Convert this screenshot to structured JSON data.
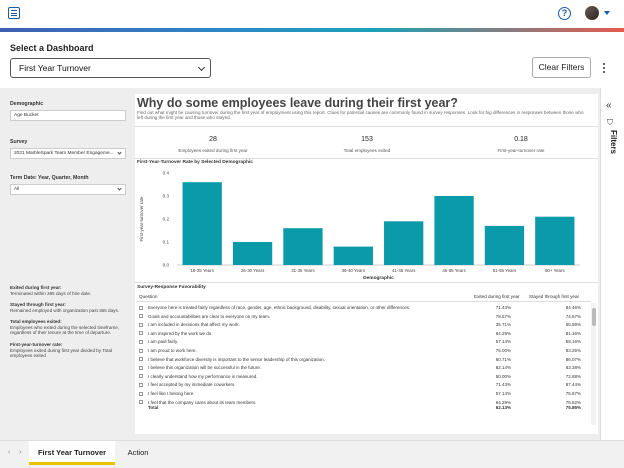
{
  "header": {
    "select_label": "Select a Dashboard",
    "dashboard_value": "First Year Turnover",
    "clear_filters_label": "Clear Filters"
  },
  "filters": {
    "demographic_label": "Demographic",
    "demographic_value": "Age Bucket",
    "survey_label": "Survey",
    "survey_value": "2021 MarbleSpark Team Member Engageme...",
    "term_date_label": "Term Date: Year, Quarter, Month",
    "term_date_value": "All",
    "rail_label": "Filters"
  },
  "definitions": [
    {
      "title": "Exited during first year:",
      "text": "Terminated within 365 days of hire date."
    },
    {
      "title": "Stayed through first year:",
      "text": "Remained employed with organization past 365 days."
    },
    {
      "title": "Total employees exited:",
      "text": "Employees who exited during the selected timeframe, regardless of their tenure at the time of departure."
    },
    {
      "title": "First-year-turnover rate:",
      "text": "Employees exited during first year divided by Total employees exited"
    }
  ],
  "report": {
    "title": "Why do some employees leave during their first year?",
    "subtitle": "Find out what might be causing turnover during the first year of employment using this report.  Clues for potential causes are commonly found in survey responses.  Look for big differences in responses between those who left during the first year and those who stayed."
  },
  "kpis": [
    {
      "value": "28",
      "label": "Employees exited during first year"
    },
    {
      "value": "153",
      "label": "Total employees exited"
    },
    {
      "value": "0.18",
      "label": "First-year-turnover rate"
    }
  ],
  "chart_data": {
    "type": "bar",
    "title": "First-Year-Turnover Rate by Selected Demographic",
    "xlabel": "Demographic",
    "ylabel": "First-year-turnover rate",
    "categories": [
      "18-25 Years",
      "26-30 Years",
      "31-35 Years",
      "36-40 Years",
      "41-45 Years",
      "46-55 Years",
      "51-55 Years",
      "60+ Years"
    ],
    "values": [
      0.36,
      0.1,
      0.16,
      0.08,
      0.19,
      0.3,
      0.17,
      0.21
    ],
    "ylim": [
      0,
      0.4
    ],
    "yticks": [
      "0.0",
      "0.1",
      "0.2",
      "0.3",
      "0.4"
    ],
    "bar_color": "#0a9aaa",
    "grid": false
  },
  "table": {
    "title": "Survey-Response Favorability",
    "col_question": "Question",
    "col_exited": "Exited during first year",
    "col_stayed": "Stayed through first year",
    "rows": [
      {
        "q": "Everyone here is treated fairly regardless of race, gender, age, ethnic background, disability, sexual orientation, or other differences.",
        "a": "71.43%",
        "b": "84.46%"
      },
      {
        "q": "Goals and accountabilities are clear to everyone on my team.",
        "a": "78.57%",
        "b": "74.67%"
      },
      {
        "q": "I am included in decisions that affect my work.",
        "a": "35.71%",
        "b": "55.59%"
      },
      {
        "q": "I am inspired by the work we do.",
        "a": "64.29%",
        "b": "81.16%"
      },
      {
        "q": "I am paid fairly.",
        "a": "57.14%",
        "b": "58.16%"
      },
      {
        "q": "I am proud to work here.",
        "a": "75.00%",
        "b": "83.25%"
      },
      {
        "q": "I believe that workforce diversity is important to the senior leadership of this organization.",
        "a": "60.71%",
        "b": "86.07%"
      },
      {
        "q": "I believe this organization will be successful in the future.",
        "a": "82.14%",
        "b": "83.38%"
      },
      {
        "q": "I clearly understand how my performance is measured.",
        "a": "50.00%",
        "b": "72.88%"
      },
      {
        "q": "I feel accepted by my immediate coworkers.",
        "a": "71.43%",
        "b": "87.44%"
      },
      {
        "q": "I feel like I belong here.",
        "a": "57.14%",
        "b": "75.67%"
      },
      {
        "q": "I feel that the company cares about its team members.",
        "a": "64.29%",
        "b": "75.62%"
      }
    ],
    "total_label": "Total",
    "total_a": "62.13%",
    "total_b": "75.85%"
  },
  "tabs": {
    "active": "First Year Turnover",
    "other": "Action"
  },
  "icons": {
    "menu": "menu-icon",
    "help": "help-icon",
    "collapse": "double-chevron-left-icon",
    "filter": "filter-icon"
  }
}
